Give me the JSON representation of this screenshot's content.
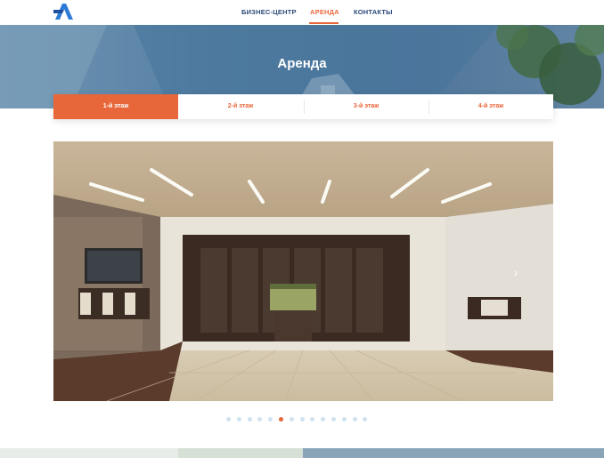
{
  "header": {
    "logo_icon": "logo-a-icon",
    "nav": [
      {
        "label": "БИЗНЕС-ЦЕНТР",
        "active": false
      },
      {
        "label": "АРЕНДА",
        "active": true
      },
      {
        "label": "КОНТАКТЫ",
        "active": false
      }
    ]
  },
  "hero": {
    "title": "Аренда"
  },
  "tabs": [
    {
      "label": "1-й этаж",
      "active": true
    },
    {
      "label": "2-й этаж",
      "active": false
    },
    {
      "label": "3-й этаж",
      "active": false
    },
    {
      "label": "4-й этаж",
      "active": false
    }
  ],
  "slider": {
    "next_icon": "chevron-right-icon",
    "slide_count": 14,
    "active_slide": 5
  },
  "colors": {
    "accent": "#e8673a",
    "nav_text": "#2a4a7a",
    "dot_inactive": "#cfe3ef"
  }
}
